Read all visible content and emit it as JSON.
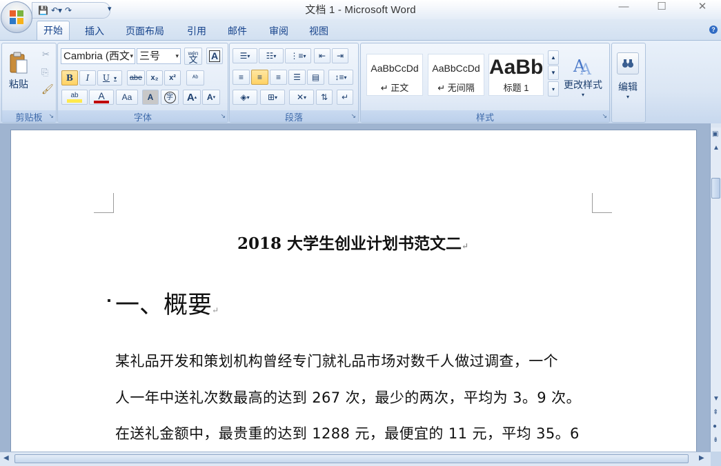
{
  "window": {
    "title": "文档 1 - Microsoft Word",
    "minimize": "—",
    "maximize": "☐",
    "close": "✕"
  },
  "tabs": [
    "开始",
    "插入",
    "页面布局",
    "引用",
    "邮件",
    "审阅",
    "视图"
  ],
  "active_tab": "开始",
  "ribbon": {
    "clipboard": {
      "paste_label": "粘贴",
      "group_label": "剪贴板"
    },
    "font": {
      "font_name": "Cambria (西文",
      "font_size": "三号",
      "phonetic_label": "wén",
      "phonetic_char": "文",
      "border_char": "A",
      "bold": "B",
      "italic": "I",
      "underline": "U",
      "strike": "abe",
      "subscript": "x₂",
      "superscript": "x²",
      "clear_format": "ᴬᵇ",
      "highlight": "ab",
      "font_color": "A",
      "change_case": "Aa",
      "char_shading": "A",
      "enclose": "字",
      "grow": "A",
      "shrink": "A",
      "group_label": "字体",
      "highlight_color": "#ffe94d",
      "font_color_value": "#c00000"
    },
    "paragraph": {
      "group_label": "段落"
    },
    "styles": {
      "tiles": [
        {
          "sample": "AaBbCcDd",
          "name": "↵ 正文"
        },
        {
          "sample": "AaBbCcDd",
          "name": "↵ 无间隔"
        },
        {
          "sample": "AaBb",
          "name": "标题 1"
        }
      ],
      "change_styles": "更改样式",
      "group_label": "样式"
    },
    "editing": {
      "label": "编辑"
    }
  },
  "document": {
    "title": "2018 大学生创业计划书范文二",
    "heading": "一、概要",
    "lines": [
      "某礼品开发和策划机构曾经专门就礼品市场对数千人做过调查，一个",
      "人一年中送礼次数最高的达到 267 次，最少的两次，平均为 3。9 次。",
      "在送礼金额中，最贵重的达到 1288 元，最便宜的 11 元，平均 35。6"
    ],
    "paragraph_mark": "↵"
  },
  "colors": {
    "ribbon_text": "#15428b",
    "accent_active": "#ffd264",
    "page_bg": "#ffffff"
  }
}
